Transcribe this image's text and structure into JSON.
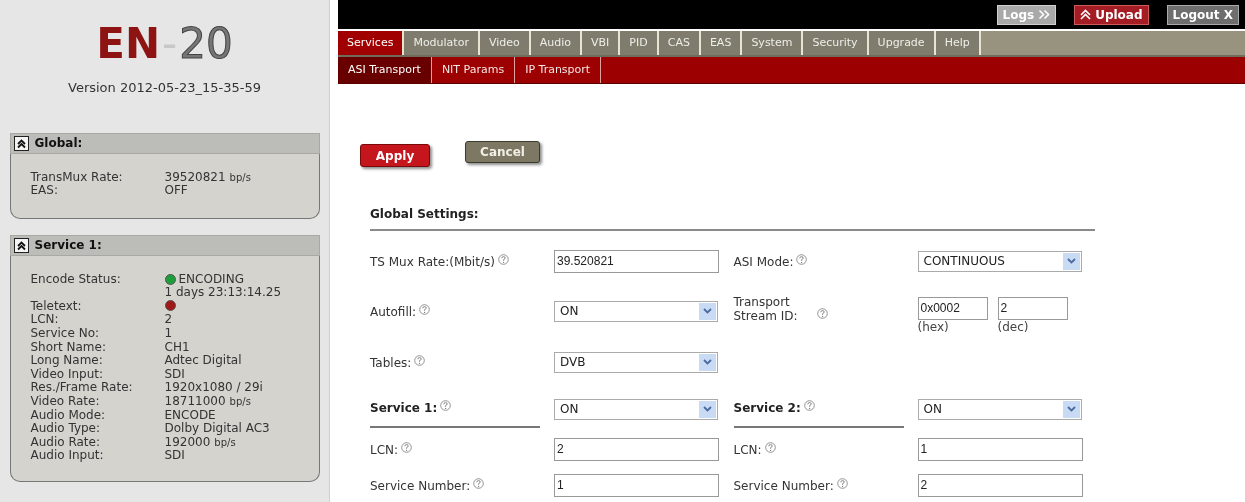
{
  "logo": {
    "prefix": "EN",
    "separator": "-",
    "suffix": "20"
  },
  "version": "Version 2012-05-23_15-35-59",
  "panels": [
    {
      "title": "Global:",
      "expanded": true,
      "rows": [
        {
          "label": "TransMux Rate:",
          "value": "39520821",
          "unit": "bp/s"
        },
        {
          "label": "EAS:",
          "value": "OFF"
        }
      ]
    },
    {
      "title": "Service 1:",
      "expanded": true,
      "rows": [
        {
          "label": "Encode Status:",
          "value": "ENCODING",
          "color": "#1e9e3a",
          "detail": "1 days 23:13:14.25"
        },
        {
          "label": "Teletext:",
          "color": "#a01818"
        },
        {
          "label": "LCN:",
          "value": "2"
        },
        {
          "label": "Service No:",
          "value": "1"
        },
        {
          "label": "Short Name:",
          "value": "CH1"
        },
        {
          "label": "Long Name:",
          "value": "Adtec Digital"
        },
        {
          "label": "Video Input:",
          "value": "SDI"
        },
        {
          "label": "Res./Frame Rate:",
          "value": "1920x1080 / 29i"
        },
        {
          "label": "Video Rate:",
          "value": "18711000",
          "unit": "bp/s"
        },
        {
          "label": "Audio Mode:",
          "value": "ENCODE"
        },
        {
          "label": "Audio Type:",
          "value": "Dolby Digital AC3"
        },
        {
          "label": "Audio Rate:",
          "value": "192000",
          "unit": "bp/s"
        },
        {
          "label": "Audio Input:",
          "value": "SDI"
        }
      ]
    }
  ],
  "top_buttons": [
    {
      "label": "Logs",
      "kind": "logs"
    },
    {
      "label": "Upload",
      "kind": "upload"
    },
    {
      "label": "Logout X",
      "kind": "logout"
    }
  ],
  "tabs": [
    {
      "label": "Services",
      "selected": true
    },
    {
      "label": "Modulator",
      "selected": false
    },
    {
      "label": "Video",
      "selected": false
    },
    {
      "label": "Audio",
      "selected": false
    },
    {
      "label": "VBI",
      "selected": false
    },
    {
      "label": "PID",
      "selected": false
    },
    {
      "label": "CAS",
      "selected": false
    },
    {
      "label": "EAS",
      "selected": false
    },
    {
      "label": "System",
      "selected": false
    },
    {
      "label": "Security",
      "selected": false
    },
    {
      "label": "Upgrade",
      "selected": false
    },
    {
      "label": "Help",
      "selected": false
    }
  ],
  "subtabs": [
    {
      "label": "ASI Transport",
      "selected": true
    },
    {
      "label": "NIT Params",
      "selected": false
    },
    {
      "label": "IP Transport",
      "selected": false
    }
  ],
  "actions": [
    {
      "label": "Apply",
      "kind": "primary"
    },
    {
      "label": "Cancel",
      "kind": "secondary"
    }
  ],
  "global_settings": {
    "title": "Global Settings:",
    "rows": [
      {
        "left": {
          "kind": "text",
          "label": "TS Mux Rate:(Mbit/s)",
          "value": "39.520821"
        },
        "right": {
          "kind": "select",
          "label": "ASI Mode:",
          "value": "CONTINUOUS"
        }
      },
      {
        "left": {
          "kind": "select",
          "label": "Autofill:",
          "value": "ON"
        },
        "right": {
          "kind": "pair",
          "label": "Transport Stream ID:",
          "values": [
            {
              "value": "0x0002",
              "caption": "(hex)"
            },
            {
              "value": "2",
              "caption": "(dec)"
            }
          ]
        }
      },
      {
        "left": {
          "kind": "select",
          "label": "Tables:",
          "value": "DVB"
        }
      },
      {
        "left": {
          "kind": "heading",
          "label": "Service 1:",
          "value": "ON"
        },
        "right": {
          "kind": "heading",
          "label": "Service 2:",
          "value": "ON"
        }
      },
      {
        "left": {
          "kind": "text",
          "label": "LCN:",
          "value": "2"
        },
        "right": {
          "kind": "text",
          "label": "LCN:",
          "value": "1"
        }
      },
      {
        "left": {
          "kind": "text",
          "label": "Service Number:",
          "value": "1"
        },
        "right": {
          "kind": "text",
          "label": "Service Number:",
          "value": "2"
        }
      }
    ]
  }
}
